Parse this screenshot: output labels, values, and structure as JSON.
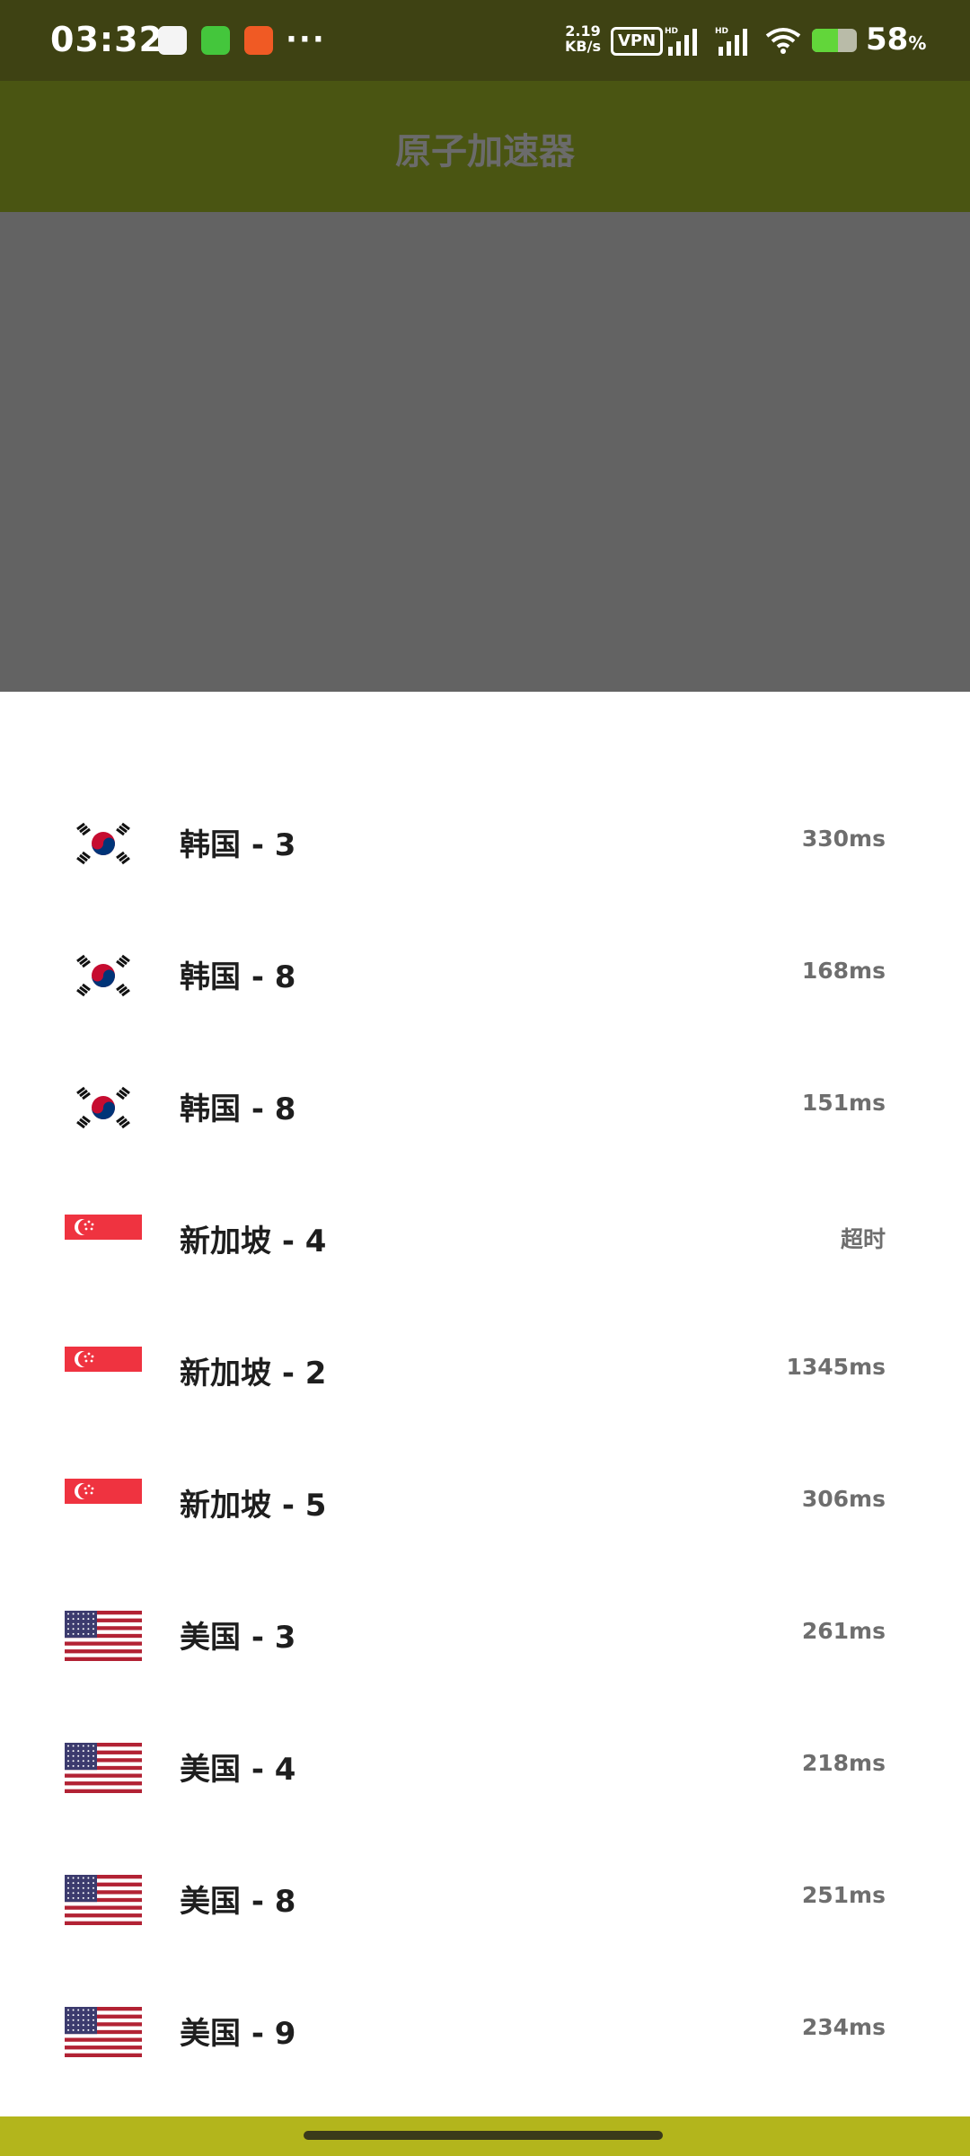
{
  "status_bar": {
    "time": "03:32",
    "net_speed_value": "2.19",
    "net_speed_unit": "KB/s",
    "vpn_label": "VPN",
    "more_label": "···",
    "battery_percent": "58",
    "battery_unit": "%",
    "battery_level": 0.58,
    "icons": [
      "notification-app-icon",
      "charging-app-icon",
      "weibo-app-icon",
      "hd-signal-icon",
      "hd-signal-icon",
      "wifi-icon",
      "battery-charging-icon"
    ]
  },
  "app_bar": {
    "title": "原子加速器"
  },
  "servers": [
    {
      "flag": "south-korea",
      "name": "韩国 - 3",
      "latency": "330ms"
    },
    {
      "flag": "south-korea",
      "name": "韩国 - 8",
      "latency": "168ms"
    },
    {
      "flag": "south-korea",
      "name": "韩国 - 8",
      "latency": "151ms"
    },
    {
      "flag": "singapore",
      "name": "新加坡 - 4",
      "latency": "超时"
    },
    {
      "flag": "singapore",
      "name": "新加坡 - 2",
      "latency": "1345ms"
    },
    {
      "flag": "singapore",
      "name": "新加坡 - 5",
      "latency": "306ms"
    },
    {
      "flag": "usa",
      "name": "美国 - 3",
      "latency": "261ms"
    },
    {
      "flag": "usa",
      "name": "美国 - 4",
      "latency": "218ms"
    },
    {
      "flag": "usa",
      "name": "美国 - 8",
      "latency": "251ms"
    },
    {
      "flag": "usa",
      "name": "美国 - 9",
      "latency": "234ms"
    }
  ],
  "colors": {
    "status_bar_bg": "#3e4213",
    "app_bar_bg": "#4a5512",
    "overlay_gray": "#636363",
    "nav_bar_bg": "#b3b51c",
    "text_primary": "#1e1e1e",
    "text_secondary": "#6e6e6e"
  }
}
